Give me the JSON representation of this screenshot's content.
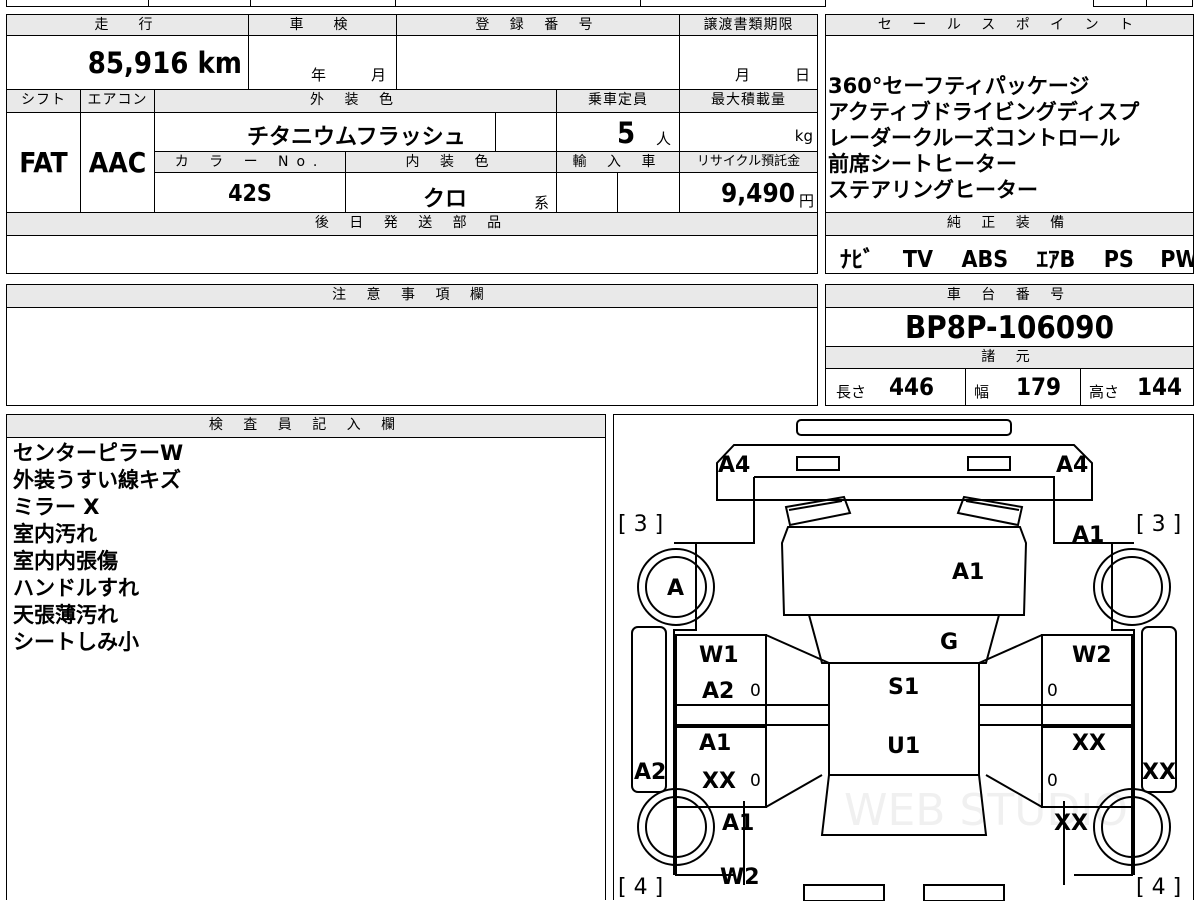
{
  "top_partial": {
    "text1": "・",
    "text2": "ij"
  },
  "vehicle": {
    "mileage_label": "走　行",
    "mileage": "85,916 km",
    "shaken_label": "車　検",
    "shaken_year": "年",
    "shaken_month": "月",
    "reg_label": "登 録 番 号",
    "transfer_label": "譲渡書類期限",
    "transfer_month": "月",
    "transfer_day": "日",
    "shift_label": "シフト",
    "ac_label": "エアコン",
    "ext_color_label": "外 装 色",
    "capacity_label": "乗車定員",
    "maxload_label": "最大積載量",
    "shift": "FAT",
    "ac": "AAC",
    "ext_color": "チタニウムフラッシュ",
    "capacity": "5",
    "capacity_unit": "人",
    "maxload_unit": "kg",
    "color_no_label": "カ ラ ー No.",
    "int_color_label": "内 装 色",
    "import_label": "輸 入 車",
    "recycle_label": "リサイクル預託金",
    "color_no": "42S",
    "int_color": "クロ",
    "int_color_suffix": "系",
    "recycle_fee": "9,490",
    "recycle_unit": "円",
    "later_parts_label": "後 日 発 送 部 品"
  },
  "sales_points": {
    "label": "セ ー ル ス ポ イ ン ト",
    "items": [
      "360°セーフティパッケージ",
      "アクティブドライビングディスプ",
      "レーダークルーズコントロール",
      "前席シートヒーター",
      "ステアリングヒーター"
    ]
  },
  "equipment": {
    "label": "純 正 装 備",
    "items": [
      "ﾅﾋﾞ",
      "TV",
      "ABS",
      "ｴｱB",
      "PS",
      "PW"
    ]
  },
  "notes": {
    "label": "注 意 事 項 欄"
  },
  "chassis": {
    "label": "車 台 番 号",
    "number": "BP8P-106090"
  },
  "specs": {
    "label": "諸 元",
    "length_label": "長さ",
    "length": "446",
    "width_label": "幅",
    "width": "179",
    "height_label": "高さ",
    "height": "144"
  },
  "inspector": {
    "label": "検 査 員 記 入 欄",
    "lines": [
      "センターピラーW",
      "外装うすい線キズ",
      "ミラー X",
      "室内汚れ",
      "室内内張傷",
      "ハンドルすれ",
      "天張薄汚れ",
      "シートしみ小"
    ]
  },
  "diagram": {
    "marks": {
      "front_left": "A4",
      "front_right": "A4",
      "bracket_front_left": "[ 3 ]",
      "bracket_front_right": "[ 3 ]",
      "bracket_rear_left": "[ 4 ]",
      "bracket_rear_right": "[ 4 ]",
      "hood": "A1",
      "hood_right": "A1",
      "wheel_front_left": "A",
      "windshield": "G",
      "roof": "S1",
      "floor": "U1",
      "front_door_left_1": "W1",
      "front_door_left_2": "A2",
      "front_door_right": "W2",
      "rear_door_left_1": "A1",
      "rear_door_left_2": "XX",
      "rear_door_right": "XX",
      "side_left": "A2",
      "side_right": "XX",
      "rear_fender_left": "A1",
      "rear_fender_right": "XX",
      "rear_bottom_left": "W2",
      "zero": "0"
    },
    "watermark": "WEB STUDIO"
  }
}
